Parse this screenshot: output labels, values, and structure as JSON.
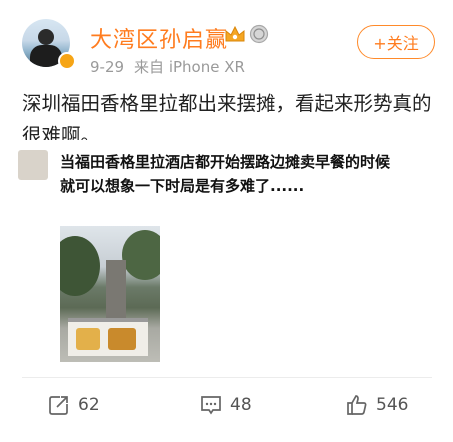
{
  "user": {
    "name": "大湾区孙启赢"
  },
  "meta": {
    "date": "9-29",
    "source": "来自 iPhone XR"
  },
  "follow": {
    "label": "+关注"
  },
  "post": {
    "text": "深圳福田香格里拉都出来摆摊，看起来形势真的很难啊。"
  },
  "embedded": {
    "text": "当福田香格里拉酒店都开始摆路边摊卖早餐的时候就可以想象一下时局是有多难了......"
  },
  "actions": {
    "reposts": "62",
    "comments": "48",
    "likes": "546"
  },
  "colors": {
    "accent": "#ff7c1f",
    "text": "#222222",
    "muted": "#9a9a9a"
  },
  "icons": [
    "crown-icon",
    "medal-icon",
    "repost-icon",
    "comment-icon",
    "like-icon"
  ]
}
